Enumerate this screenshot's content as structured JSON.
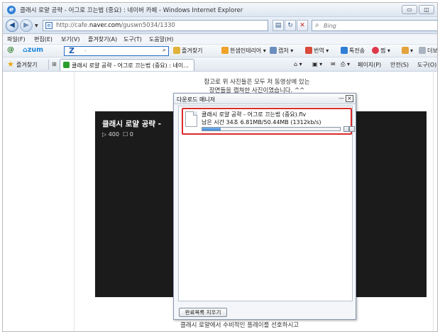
{
  "window": {
    "title": "클래시 로얄 공략 - 어그로 끄는법 (중요) : 네이버 카페 - Windows Internet Explorer",
    "minimize": "▭",
    "restore": "◫"
  },
  "address_bar": {
    "url_prefix": "http://cafe.",
    "url_domain": "naver.com",
    "url_path": "/guswn5034/1330",
    "search_placeholder": "Bing"
  },
  "menu": {
    "items": [
      "파일(F)",
      "편집(E)",
      "보기(V)",
      "즐겨찾기(A)",
      "도구(T)",
      "도움말(H)"
    ]
  },
  "zum_toolbar": {
    "logo": "zum",
    "search_letter": "Z",
    "search_value": "-",
    "tools": [
      "즐겨찾기",
      "한샘인테리어",
      "캡처",
      "번역",
      "톡전송",
      "찜",
      "더보기"
    ]
  },
  "favorites_bar": {
    "label": "즐겨찾기",
    "tab_title": "클래시 로얄 공략 - 어그로 끄는법 (중요) : 네이...",
    "commands": [
      "페이지(P)",
      "안전(S)",
      "도구(O)"
    ]
  },
  "page": {
    "notice_line1": "참고로 위 사진들은 모두 저 동영상에 있는",
    "notice_line2": "장면들을 캡쳐한 사진이였습니다. ^^",
    "video_title": "클래시 로얄 공략 -",
    "video_views": "▷ 400",
    "video_comments": "☐ 0",
    "caption": "클래시 로얄에서 수비적인 플레이를 선호하시고"
  },
  "download_manager": {
    "title": "다운로드 매니저",
    "minimize": "—",
    "close": "×",
    "item": {
      "filename": "클래시 로얄 공략 - 어그로 끄는법 (중요).flv",
      "status": "남은 시간 34초 6.81MB/50.44MB (1312kb/s)",
      "progress": 0.135
    },
    "clear_button": "완료목록 지우기"
  }
}
